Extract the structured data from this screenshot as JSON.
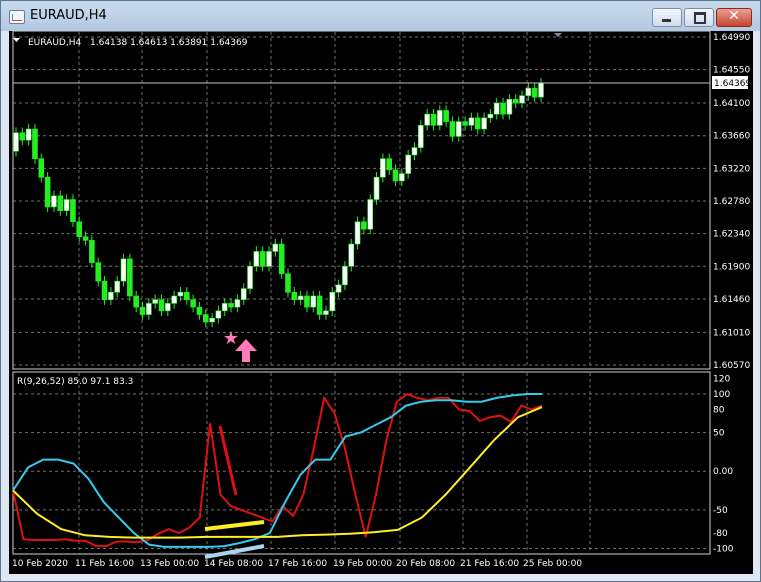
{
  "window": {
    "title": "EURAUD,H4",
    "minimize_icon": "minimize-icon",
    "maximize_icon": "maximize-icon",
    "close_icon": "close-icon"
  },
  "colors": {
    "background": "#000000",
    "grid": "#a0a0a0",
    "bull_candle": "#ffffff",
    "bear_candle": "#22ee22",
    "wick": "#22ee22",
    "fast_line": "#e01010",
    "signal_line": "#33ccee",
    "slow_line": "#ffee22"
  },
  "chart_data": [
    {
      "type": "candlestick",
      "title": "EURAUD,H4",
      "ohlc_readout": "1.64138 1.64613 1.63891 1.64369",
      "current_price": "1.64369",
      "y_ticks": [
        "1.64990",
        "1.64550",
        "1.64100",
        "1.63660",
        "1.63220",
        "1.62780",
        "1.62340",
        "1.61900",
        "1.61460",
        "1.61010",
        "1.60570"
      ],
      "ylim": [
        1.6057,
        1.6499
      ],
      "x_labels": [
        "10 Feb 2020",
        "11 Feb 16:00",
        "13 Feb 00:00",
        "14 Feb 08:00",
        "17 Feb 16:00",
        "19 Feb 00:00",
        "20 Feb 08:00",
        "21 Feb 16:00",
        "25 Feb 00:00"
      ],
      "close": [
        1.637,
        1.636,
        1.6375,
        1.6335,
        1.631,
        1.627,
        1.6285,
        1.6265,
        1.628,
        1.625,
        1.623,
        1.6225,
        1.6195,
        1.617,
        1.6145,
        1.6155,
        1.617,
        1.62,
        1.615,
        1.6135,
        1.6125,
        1.614,
        1.6145,
        1.613,
        1.614,
        1.615,
        1.6155,
        1.6145,
        1.6135,
        1.6125,
        1.6115,
        1.612,
        1.613,
        1.614,
        1.6135,
        1.6145,
        1.616,
        1.619,
        1.621,
        1.619,
        1.621,
        1.622,
        1.618,
        1.6155,
        1.6145,
        1.615,
        1.6135,
        1.615,
        1.6125,
        1.613,
        1.6155,
        1.6165,
        1.619,
        1.622,
        1.625,
        1.624,
        1.628,
        1.631,
        1.6335,
        1.632,
        1.6305,
        1.6315,
        1.634,
        1.635,
        1.638,
        1.6395,
        1.638,
        1.64,
        1.6385,
        1.6365,
        1.6385,
        1.638,
        1.639,
        1.6375,
        1.639,
        1.6395,
        1.641,
        1.6395,
        1.6415,
        1.641,
        1.642,
        1.643,
        1.6418,
        1.6437
      ],
      "subchart": {
        "label": "R(9,26,52) 85.0 97.1 83.3",
        "y_ticks": [
          "120",
          "100",
          "80",
          "50",
          "0.00",
          "-50",
          "-80",
          "-100"
        ],
        "ylim": [
          -102,
          122
        ],
        "series": [
          {
            "name": "85.0",
            "color": "#e01010",
            "values": [
              -25,
              -88,
              -89,
              -89,
              -89,
              -88,
              -90,
              -90,
              -97,
              -97,
              -91,
              -91,
              -92,
              -89,
              -81,
              -75,
              -80,
              -73,
              -60,
              62,
              -30,
              -45,
              -50,
              -55,
              -60,
              -65,
              -45,
              -58,
              -30,
              30,
              95,
              75,
              30,
              -30,
              -85,
              -30,
              40,
              90,
              100,
              95,
              92,
              95,
              95,
              80,
              78,
              65,
              70,
              72,
              64,
              85,
              80,
              85
            ]
          },
          {
            "name": "97.1",
            "color": "#33ccee",
            "values": [
              -25,
              5,
              15,
              15,
              10,
              -10,
              -40,
              -60,
              -80,
              -95,
              -98,
              -98,
              -98,
              -98,
              -97,
              -93,
              -88,
              -80,
              -40,
              -5,
              15,
              15,
              45,
              50,
              60,
              70,
              85,
              90,
              92,
              92,
              90,
              90,
              95,
              98,
              100,
              100
            ]
          },
          {
            "name": "83.3",
            "color": "#ffee22",
            "values": [
              -25,
              -55,
              -75,
              -83,
              -85,
              -86,
              -86,
              -86,
              -85,
              -85,
              -85,
              -85,
              -83,
              -82,
              -81,
              -79,
              -76,
              -60,
              -30,
              5,
              40,
              70,
              83
            ]
          }
        ]
      }
    }
  ]
}
